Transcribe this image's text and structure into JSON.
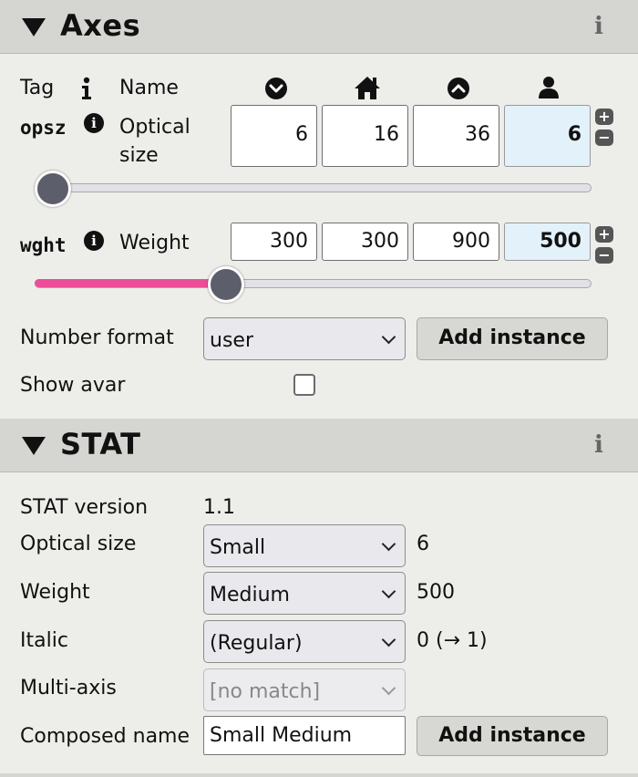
{
  "axes_panel": {
    "title": "Axes",
    "info": "i",
    "col_tag": "Tag",
    "col_name": "Name",
    "rows": [
      {
        "tag": "opsz",
        "name": "Optical size",
        "min": "6",
        "default": "16",
        "max": "36",
        "user": "6",
        "slider_fraction": 0.0
      },
      {
        "tag": "wght",
        "name": "Weight",
        "min": "300",
        "default": "300",
        "max": "900",
        "user": "500",
        "slider_fraction": 0.333
      }
    ],
    "number_format_label": "Number format",
    "number_format_value": "user",
    "add_instance_label": "Add instance",
    "show_avar_label": "Show avar",
    "show_avar_checked": false,
    "colors": {
      "accent": "#ec4d98",
      "user_field": "#e3f1fb"
    }
  },
  "stat_panel": {
    "title": "STAT",
    "info": "i",
    "version_label": "STAT version",
    "version_value": "1.1",
    "optical_size_label": "Optical size",
    "optical_size_select": "Small",
    "optical_size_value": "6",
    "weight_label": "Weight",
    "weight_select": "Medium",
    "weight_value": "500",
    "italic_label": "Italic",
    "italic_select": "(Regular)",
    "italic_value": "0 (→ 1)",
    "multi_axis_label": "Multi-axis",
    "multi_axis_select": "[no match]",
    "composed_name_label": "Composed name",
    "composed_name_value": "Small Medium",
    "add_instance_label": "Add instance"
  }
}
